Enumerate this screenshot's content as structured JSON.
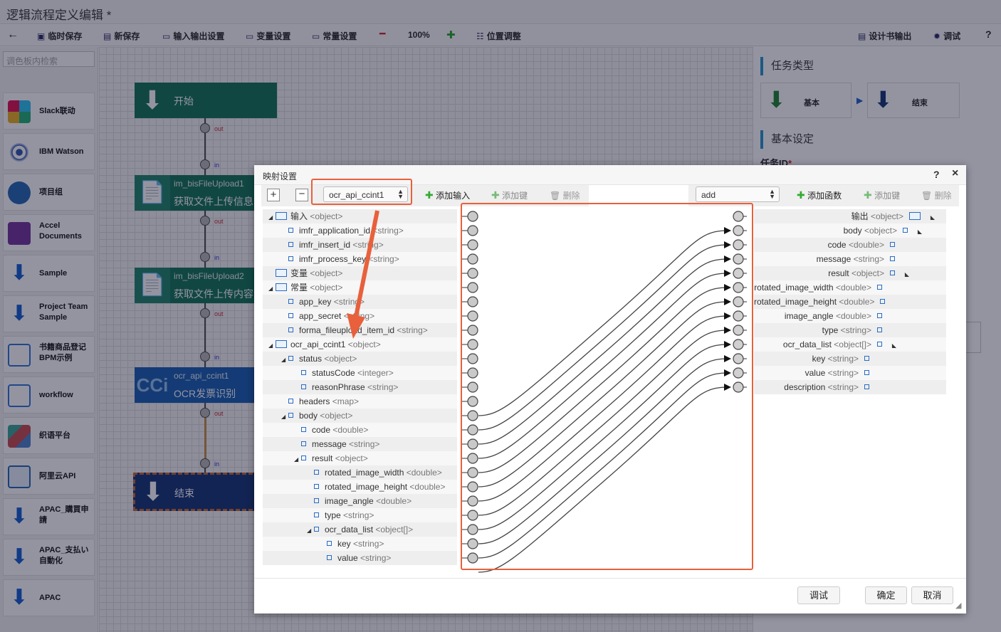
{
  "window": {
    "title": "逻辑流程定义编辑 *"
  },
  "toolbar": {
    "back_icon": "arrow-left-icon",
    "temp_save": "临时保存",
    "new_save": "新保存",
    "io_settings": "输入输出设置",
    "var_settings": "变量设置",
    "const_settings": "常量设置",
    "zoom": "100%",
    "position_adjust": "位置调整",
    "design_output": "设计书输出",
    "debug": "调试",
    "help": "?"
  },
  "palette": {
    "search_placeholder": "调色板内检索",
    "items": [
      {
        "label": "Slack联动"
      },
      {
        "label": "IBM Watson"
      },
      {
        "label": "项目组"
      },
      {
        "label": "Accel Documents"
      },
      {
        "label": "Sample"
      },
      {
        "label": "Project Team Sample"
      },
      {
        "label": "书籍商品登记BPM示例"
      },
      {
        "label": "workflow"
      },
      {
        "label": "织语平台"
      },
      {
        "label": "阿里云API"
      },
      {
        "label": "APAC_購買申請"
      },
      {
        "label": "APAC_支払い自動化"
      },
      {
        "label": "APAC"
      }
    ]
  },
  "canvas": {
    "nodes": [
      {
        "name": "",
        "title": "开始"
      },
      {
        "name": "im_bisFileUpload1",
        "title": "获取文件上传信息"
      },
      {
        "name": "im_bisFileUpload2",
        "title": "获取文件上传内容"
      },
      {
        "name": "ocr_api_ccint1",
        "title": "OCR发票识别"
      },
      {
        "name": "",
        "title": "结束"
      }
    ],
    "port_out": "out",
    "port_in": "in"
  },
  "right_panel": {
    "task_type_title": "任务类型",
    "task_basic": "基本",
    "task_end": "结束",
    "basic_settings_title": "基本设定",
    "task_id_label": "任务ID"
  },
  "dialog": {
    "title": "映射设置",
    "help": "?",
    "close": "×",
    "source_select": "ocr_api_ccint1",
    "add_input": "添加输入",
    "add_key_left": "添加键",
    "delete_left": "删除",
    "func_select": "add",
    "add_function": "添加函数",
    "add_key_right": "添加键",
    "delete_right": "删除",
    "debug_button": "调试",
    "ok_button": "确定",
    "cancel_button": "取消",
    "left_tree": [
      {
        "name": "输入",
        "type": "<object>"
      },
      {
        "name": "imfr_application_id",
        "type": "<string>"
      },
      {
        "name": "imfr_insert_id",
        "type": "<string>"
      },
      {
        "name": "imfr_process_key",
        "type": "<string>"
      },
      {
        "name": "变量",
        "type": "<object>"
      },
      {
        "name": "常量",
        "type": "<object>"
      },
      {
        "name": "app_key",
        "type": "<string>"
      },
      {
        "name": "app_secret",
        "type": "<string>"
      },
      {
        "name": "forma_fileupload_item_id",
        "type": "<string>"
      },
      {
        "name": "ocr_api_ccint1",
        "type": "<object>"
      },
      {
        "name": "status",
        "type": "<object>"
      },
      {
        "name": "statusCode",
        "type": "<integer>"
      },
      {
        "name": "reasonPhrase",
        "type": "<string>"
      },
      {
        "name": "headers",
        "type": "<map>"
      },
      {
        "name": "body",
        "type": "<object>"
      },
      {
        "name": "code",
        "type": "<double>"
      },
      {
        "name": "message",
        "type": "<string>"
      },
      {
        "name": "result",
        "type": "<object>"
      },
      {
        "name": "rotated_image_width",
        "type": "<double>"
      },
      {
        "name": "rotated_image_height",
        "type": "<double>"
      },
      {
        "name": "image_angle",
        "type": "<double>"
      },
      {
        "name": "type",
        "type": "<string>"
      },
      {
        "name": "ocr_data_list",
        "type": "<object[]>"
      },
      {
        "name": "key",
        "type": "<string>"
      },
      {
        "name": "value",
        "type": "<string>"
      }
    ],
    "right_tree": [
      {
        "name": "输出",
        "type": "<object>"
      },
      {
        "name": "body",
        "type": "<object>"
      },
      {
        "name": "code",
        "type": "<double>"
      },
      {
        "name": "message",
        "type": "<string>"
      },
      {
        "name": "result",
        "type": "<object>"
      },
      {
        "name": "rotated_image_width",
        "type": "<double>"
      },
      {
        "name": "rotated_image_height",
        "type": "<double>"
      },
      {
        "name": "image_angle",
        "type": "<double>"
      },
      {
        "name": "type",
        "type": "<string>"
      },
      {
        "name": "ocr_data_list",
        "type": "<object[]>"
      },
      {
        "name": "key",
        "type": "<string>"
      },
      {
        "name": "value",
        "type": "<string>"
      },
      {
        "name": "description",
        "type": "<string>"
      }
    ]
  },
  "colors": {
    "highlight": "#e8603c",
    "accent": "#2a6cc7",
    "node_green": "#1e7a5e",
    "node_blue": "#2467b3"
  }
}
